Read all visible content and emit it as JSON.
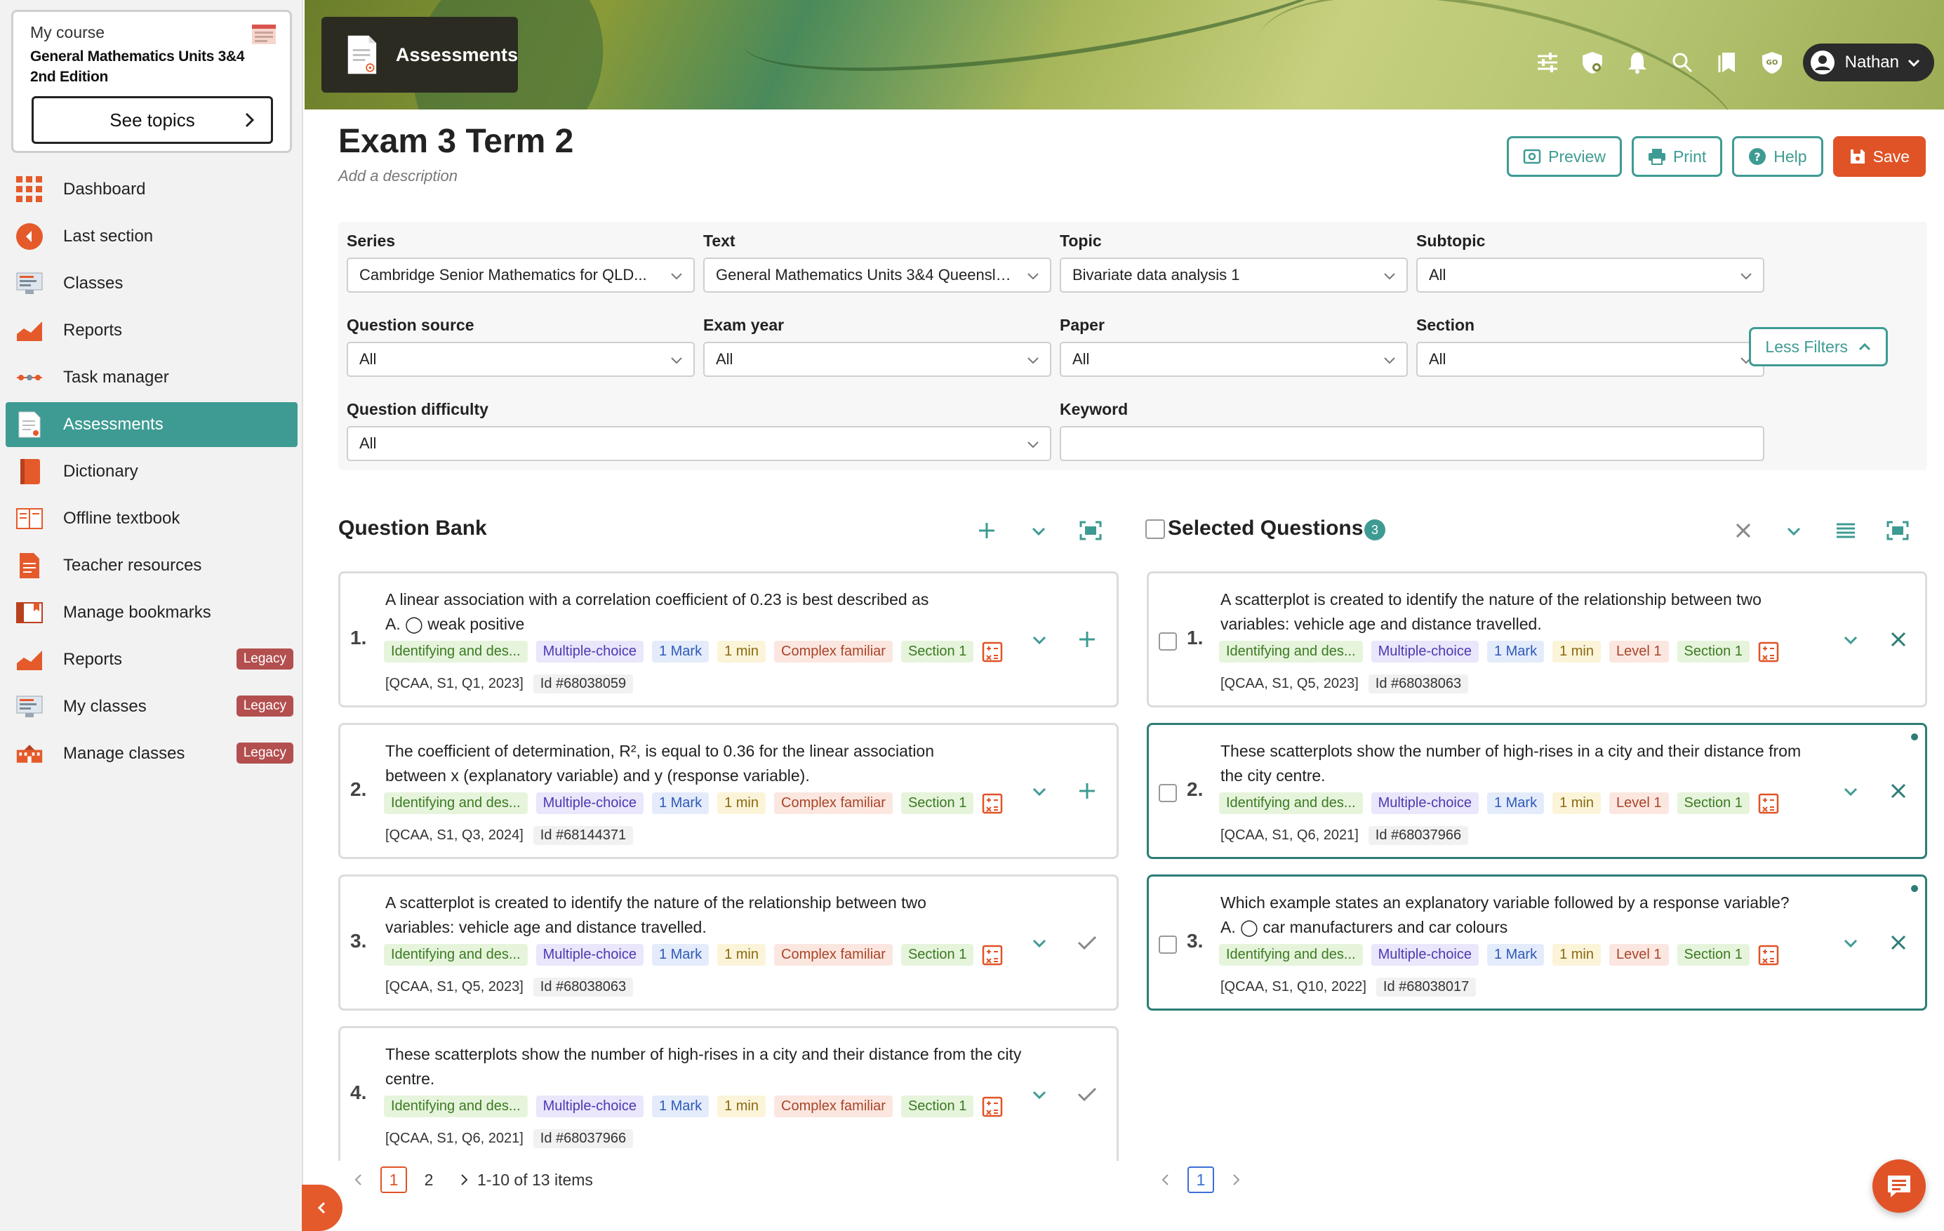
{
  "sidebar": {
    "course_label": "My course",
    "course_name": "General Mathematics Units 3&4 2nd Edition",
    "see_topics": "See topics",
    "items": [
      {
        "label": "Dashboard",
        "icon": "grid-icon",
        "legacy": ""
      },
      {
        "label": "Last section",
        "icon": "back-arrow-icon",
        "legacy": ""
      },
      {
        "label": "Classes",
        "icon": "classes-icon",
        "legacy": ""
      },
      {
        "label": "Reports",
        "icon": "chart-icon",
        "legacy": ""
      },
      {
        "label": "Task manager",
        "icon": "task-icon",
        "legacy": ""
      },
      {
        "label": "Assessments",
        "icon": "document-icon",
        "legacy": ""
      },
      {
        "label": "Dictionary",
        "icon": "book-icon",
        "legacy": ""
      },
      {
        "label": "Offline textbook",
        "icon": "open-book-icon",
        "legacy": ""
      },
      {
        "label": "Teacher resources",
        "icon": "file-icon",
        "legacy": ""
      },
      {
        "label": "Manage bookmarks",
        "icon": "bookmark-book-icon",
        "legacy": ""
      },
      {
        "label": "Reports",
        "icon": "chart-icon",
        "legacy": "Legacy"
      },
      {
        "label": "My classes",
        "icon": "classes-icon",
        "legacy": "Legacy"
      },
      {
        "label": "Manage classes",
        "icon": "school-icon",
        "legacy": "Legacy"
      }
    ]
  },
  "header": {
    "page_title": "Assessments",
    "user_name": "Nathan"
  },
  "exam": {
    "title": "Exam 3 Term 2",
    "description": "Add a description"
  },
  "actions": {
    "preview": "Preview",
    "print": "Print",
    "help": "Help",
    "save": "Save"
  },
  "filters": {
    "series": {
      "label": "Series",
      "value": "Cambridge Senior Mathematics for QLD..."
    },
    "text": {
      "label": "Text",
      "value": "General Mathematics Units 3&4 Queensland..."
    },
    "topic": {
      "label": "Topic",
      "value": "Bivariate data analysis 1"
    },
    "subtopic": {
      "label": "Subtopic",
      "value": "All"
    },
    "question_source": {
      "label": "Question source",
      "value": "All"
    },
    "exam_year": {
      "label": "Exam year",
      "value": "All"
    },
    "paper": {
      "label": "Paper",
      "value": "All"
    },
    "section": {
      "label": "Section",
      "value": "All"
    },
    "question_difficulty": {
      "label": "Question difficulty",
      "value": "All"
    },
    "keyword": {
      "label": "Keyword",
      "value": ""
    },
    "less_filters": "Less Filters"
  },
  "question_bank": {
    "title": "Question Bank",
    "questions": [
      {
        "num": "1.",
        "text": "A linear association with a correlation coefficient of 0.23 is best described as",
        "option": "A.  ◯ weak positive",
        "tags": [
          "Identifying and des...",
          "Multiple-choice",
          "1 Mark",
          "1 min",
          "Complex familiar",
          "Section 1"
        ],
        "ref": "[QCAA, S1, Q1, 2023]",
        "id": "Id #68038059",
        "state": "add"
      },
      {
        "num": "2.",
        "text": "The coefficient of determination, R², is equal to 0.36 for the linear association between x (explanatory variable) and y (response variable).",
        "option": "",
        "tags": [
          "Identifying and des...",
          "Multiple-choice",
          "1 Mark",
          "1 min",
          "Complex familiar",
          "Section 1"
        ],
        "ref": "[QCAA, S1, Q3, 2024]",
        "id": "Id #68144371",
        "state": "add"
      },
      {
        "num": "3.",
        "text": "A scatterplot is created to identify the nature of the relationship between two variables: vehicle age and distance travelled.",
        "option": "",
        "tags": [
          "Identifying and des...",
          "Multiple-choice",
          "1 Mark",
          "1 min",
          "Complex familiar",
          "Section 1"
        ],
        "ref": "[QCAA, S1, Q5, 2023]",
        "id": "Id #68038063",
        "state": "added"
      },
      {
        "num": "4.",
        "text": "These scatterplots show the number of high-rises in a city and their distance from the city centre.",
        "option": "",
        "tags": [
          "Identifying and des...",
          "Multiple-choice",
          "1 Mark",
          "1 min",
          "Complex familiar",
          "Section 1"
        ],
        "ref": "[QCAA, S1, Q6, 2021]",
        "id": "Id #68037966",
        "state": "added"
      }
    ],
    "pager": {
      "page1": "1",
      "page2": "2",
      "summary": "1-10 of 13 items"
    }
  },
  "selected": {
    "title": "Selected Questions",
    "count": "3",
    "questions": [
      {
        "num": "1.",
        "text": "A scatterplot is created to identify the nature of the relationship between two variables: vehicle age and distance travelled.",
        "option": "",
        "tags": [
          "Identifying and des...",
          "Multiple-choice",
          "1 Mark",
          "1 min",
          "Level 1",
          "Section 1"
        ],
        "ref": "[QCAA, S1, Q5, 2023]",
        "id": "Id #68038063",
        "highlight": false
      },
      {
        "num": "2.",
        "text": "These scatterplots show the number of high-rises in a city and their distance from the city centre.",
        "option": "",
        "tags": [
          "Identifying and des...",
          "Multiple-choice",
          "1 Mark",
          "1 min",
          "Level 1",
          "Section 1"
        ],
        "ref": "[QCAA, S1, Q6, 2021]",
        "id": "Id #68037966",
        "highlight": true
      },
      {
        "num": "3.",
        "text": "Which example states an explanatory variable followed by a response variable?",
        "option": "A.  ◯ car manufacturers and car colours",
        "tags": [
          "Identifying and des...",
          "Multiple-choice",
          "1 Mark",
          "1 min",
          "Level 1",
          "Section 1"
        ],
        "ref": "[QCAA, S1, Q10, 2022]",
        "id": "Id #68038017",
        "highlight": true
      }
    ],
    "pager": {
      "page1": "1"
    }
  },
  "colors": {
    "accent": "#3e9b93",
    "brand": "#e05327",
    "legacy": "#b34f4f"
  }
}
